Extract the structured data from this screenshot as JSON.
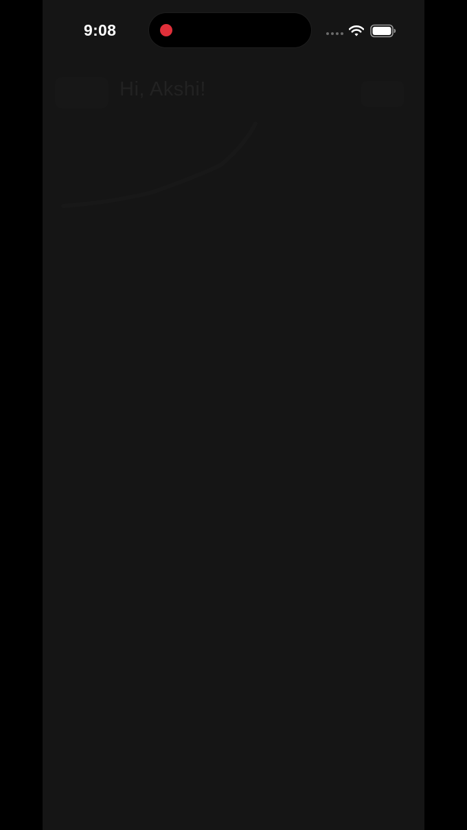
{
  "status_bar": {
    "time": "9:08",
    "recording_color": "#e0303a",
    "icons": [
      "cellular-icon",
      "wifi-icon",
      "battery-icon"
    ]
  },
  "header": {
    "greeting": "Hi, Akshi!"
  },
  "theme": {
    "background": "#151515",
    "outer": "#000000"
  }
}
